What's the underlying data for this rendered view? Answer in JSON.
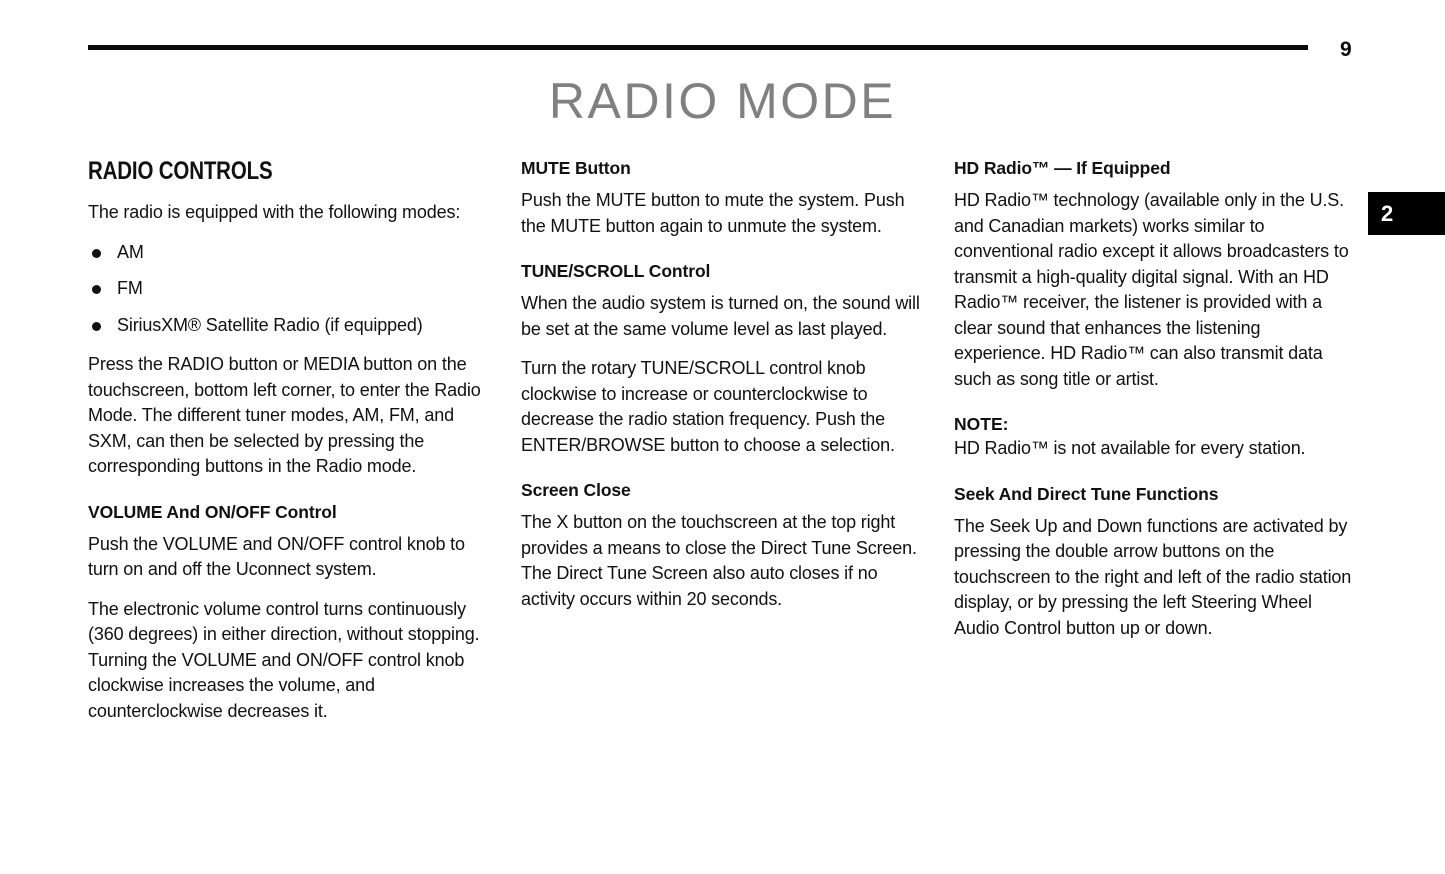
{
  "header": {
    "page_number": "9",
    "title": "RADIO MODE",
    "rule_color": "#0a0a0a"
  },
  "chapter_tab": {
    "number": "2",
    "background": "#000000",
    "text_color": "#ffffff"
  },
  "columns": {
    "col1": {
      "section_title": "RADIO CONTROLS",
      "intro": "The radio is equipped with the following modes:",
      "modes": [
        "AM",
        "FM",
        "SiriusXM® Satellite Radio (if equipped)"
      ],
      "paragraph_1": "Press the RADIO button or MEDIA button on the touchscreen, bottom left corner, to enter the Radio Mode. The different tuner modes, AM, FM, and SXM, can then be selected by pressing the corresponding buttons in the Radio mode.",
      "volume_heading": "VOLUME And ON/OFF Control",
      "volume_paragraph_1": "Push the VOLUME and ON/OFF control knob to turn on and off the Uconnect system.",
      "volume_paragraph_2": "The electronic volume control turns continuously (360 degrees) in either direction, without stopping. Turning the VOLUME and ON/OFF control knob clockwise increases the volume, and counterclockwise decreases it."
    },
    "col2": {
      "mute_heading": "MUTE Button",
      "mute_paragraph": "Push the MUTE button to mute the system. Push the MUTE button again to unmute the system.",
      "tune_heading": "TUNE/SCROLL Control",
      "tune_paragraph_1": "When the audio system is turned on, the sound will be set at the same volume level as last played.",
      "tune_paragraph_2": "Turn the rotary TUNE/SCROLL control knob clockwise to increase or counterclockwise to decrease the radio station frequency. Push the ENTER/BROWSE button to choose a selection.",
      "screen_close_heading": "Screen Close",
      "screen_close_paragraph": "The X button on the touchscreen at the top right provides a means to close the Direct Tune Screen. The Direct Tune Screen also auto closes if no activity occurs within 20 seconds."
    },
    "col3": {
      "hd_heading": "HD Radio™ — If Equipped",
      "hd_paragraph": "HD Radio™ technology (available only in the U.S. and Canadian markets) works similar to conventional radio except it allows broadcasters to transmit a high-quality digital signal. With an HD Radio™ receiver, the listener is provided with a clear sound that enhances the listening experience. HD Radio™ can also transmit data such as song title or artist.",
      "note_heading": "NOTE:",
      "note_text": "HD Radio™ is not available for every station.",
      "seek_heading": "Seek And Direct Tune Functions",
      "seek_paragraph": "The Seek Up and Down functions are activated by pressing the double arrow buttons on the touchscreen to the right and left of the radio station display, or by pressing the left Steering Wheel Audio Control button up or down."
    }
  }
}
